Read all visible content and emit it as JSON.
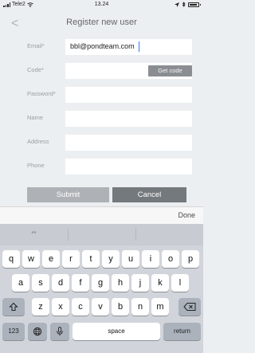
{
  "status": {
    "carrier": "Tele2",
    "time": "13.24"
  },
  "nav": {
    "back_glyph": "<",
    "title": "Register new user"
  },
  "form": {
    "email_label": "Email*",
    "email_value": "bbl@pondteam.com",
    "code_label": "Code*",
    "get_code_label": "Get code",
    "password_label": "Password*",
    "name_label": "Name",
    "address_label": "Address",
    "phone_label": "Phone"
  },
  "buttons": {
    "submit": "Submit",
    "cancel": "Cancel"
  },
  "accessory": {
    "done": "Done"
  },
  "keyboard": {
    "predictive": [
      "“”",
      "",
      ""
    ],
    "row1": [
      "q",
      "w",
      "e",
      "r",
      "t",
      "y",
      "u",
      "i",
      "o",
      "p"
    ],
    "row2": [
      "a",
      "s",
      "d",
      "f",
      "g",
      "h",
      "j",
      "k",
      "l"
    ],
    "row3": [
      "z",
      "x",
      "c",
      "v",
      "b",
      "n",
      "m"
    ],
    "numbers": "123",
    "space": "space",
    "return": "return"
  }
}
